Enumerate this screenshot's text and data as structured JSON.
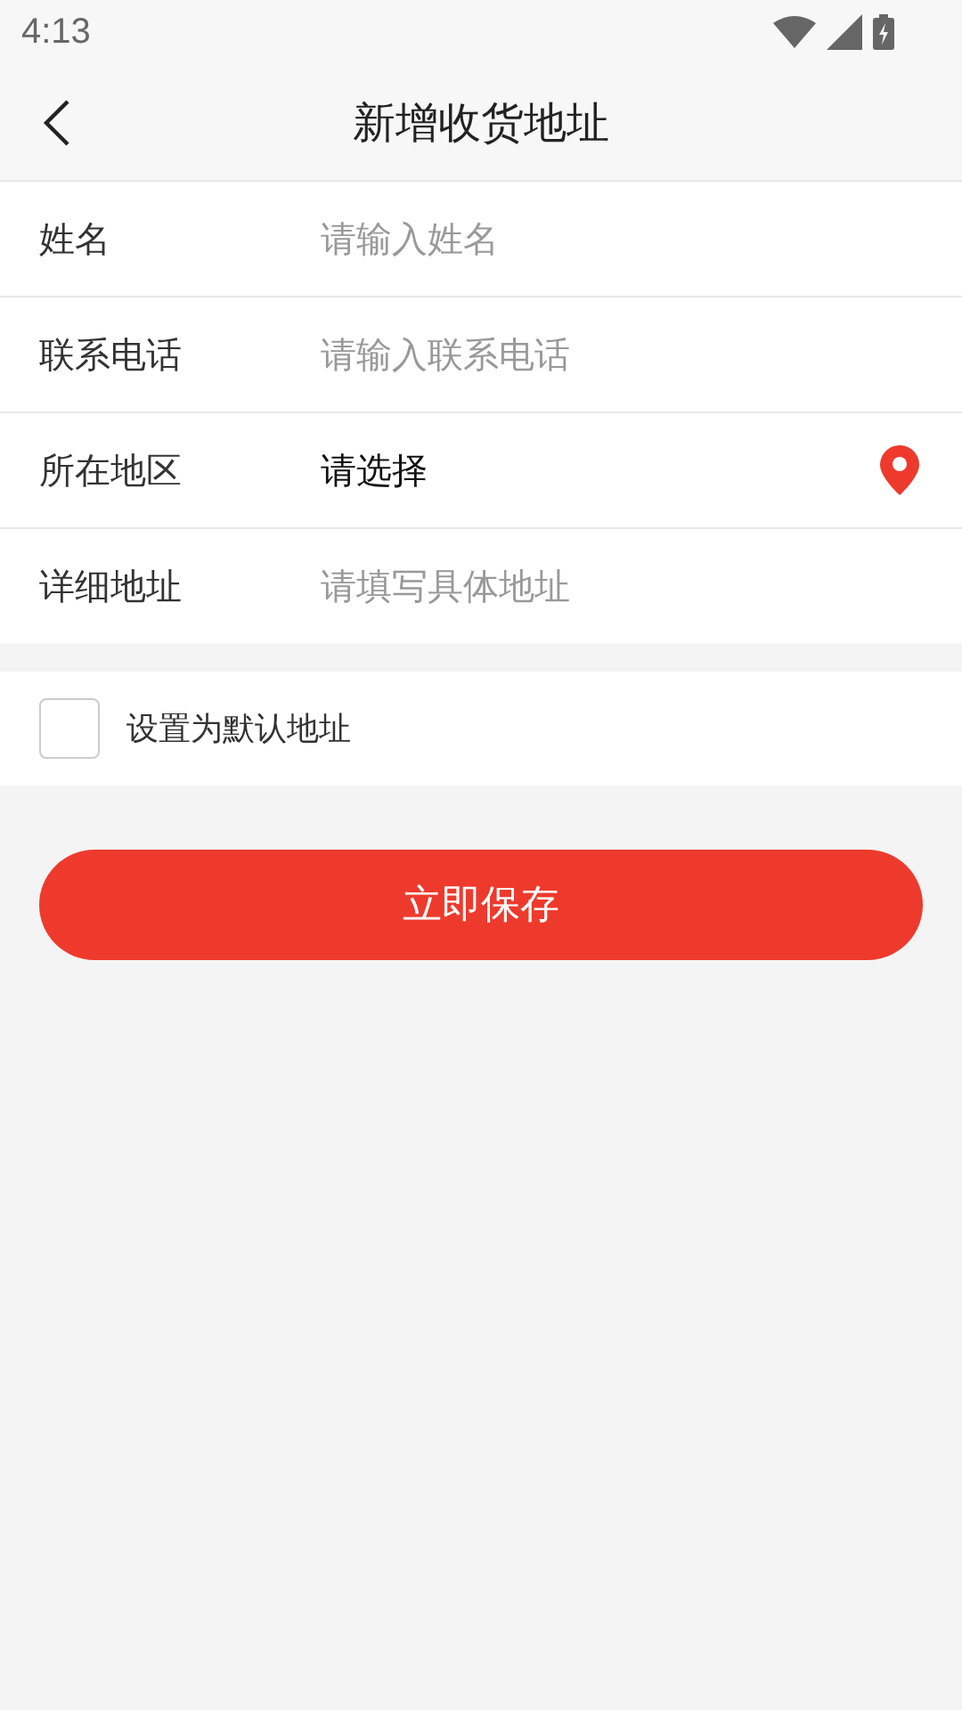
{
  "status_bar": {
    "time": "4:13"
  },
  "header": {
    "title": "新增收货地址"
  },
  "fields": [
    {
      "label": "姓名",
      "kind": "input",
      "placeholder": "请输入姓名"
    },
    {
      "label": "联系电话",
      "kind": "input",
      "placeholder": "请输入联系电话"
    },
    {
      "label": "所在地区",
      "kind": "select",
      "value": "请选择"
    },
    {
      "label": "详细地址",
      "kind": "input",
      "placeholder": "请填写具体地址"
    }
  ],
  "default_address": {
    "label": "设置为默认地址",
    "checked": false
  },
  "save_button": {
    "label": "立即保存"
  }
}
